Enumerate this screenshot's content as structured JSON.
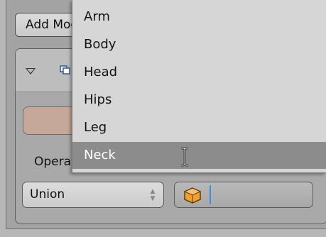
{
  "toolbar": {
    "add_modifier_label": "Add Modifier"
  },
  "modifier": {
    "operation_label": "Operation:",
    "operation_value": "Union"
  },
  "dropdown": {
    "items": [
      {
        "label": "Arm"
      },
      {
        "label": "Body"
      },
      {
        "label": "Head"
      },
      {
        "label": "Hips"
      },
      {
        "label": "Leg"
      },
      {
        "label": "Neck"
      }
    ],
    "selected": "Neck"
  },
  "colors": {
    "highlight": "#8c8c8c",
    "apply_button": "#c6a89a",
    "object_icon": "#f0a030",
    "cursor_field": "#3b8fe0"
  }
}
